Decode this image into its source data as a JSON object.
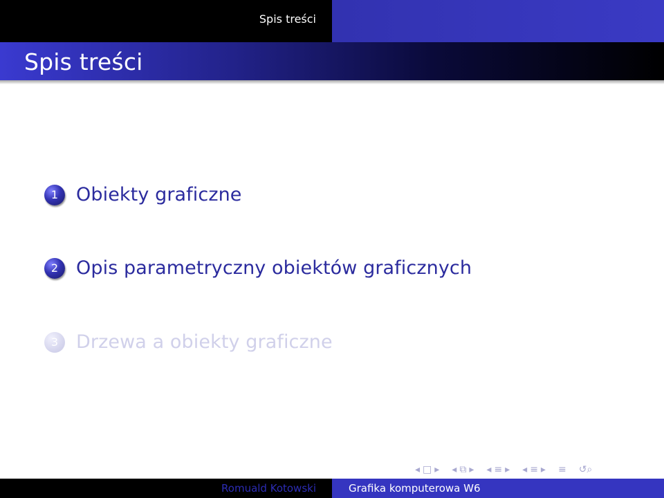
{
  "header": {
    "section_name": "Spis treści"
  },
  "frame": {
    "title": "Spis treści"
  },
  "toc": {
    "items": [
      {
        "number": "1",
        "label": "Obiekty graficzne"
      },
      {
        "number": "2",
        "label": "Opis parametryczny obiektów graficznych"
      },
      {
        "number": "3",
        "label": "Drzewa a obiekty graficzne"
      }
    ]
  },
  "navigation": {
    "prev_arrow": "◂",
    "next_arrow": "▸",
    "frame_icon": "□",
    "subsection_icon": "⧉",
    "section_icon": "≡",
    "outline_icon": "≡",
    "search_icon": "↺⌕"
  },
  "footer": {
    "author": "Romuald Kotowski",
    "title": "Grafika komputerowa W6"
  },
  "colors": {
    "accent": "#3333b3",
    "header_dark": "#000000"
  }
}
